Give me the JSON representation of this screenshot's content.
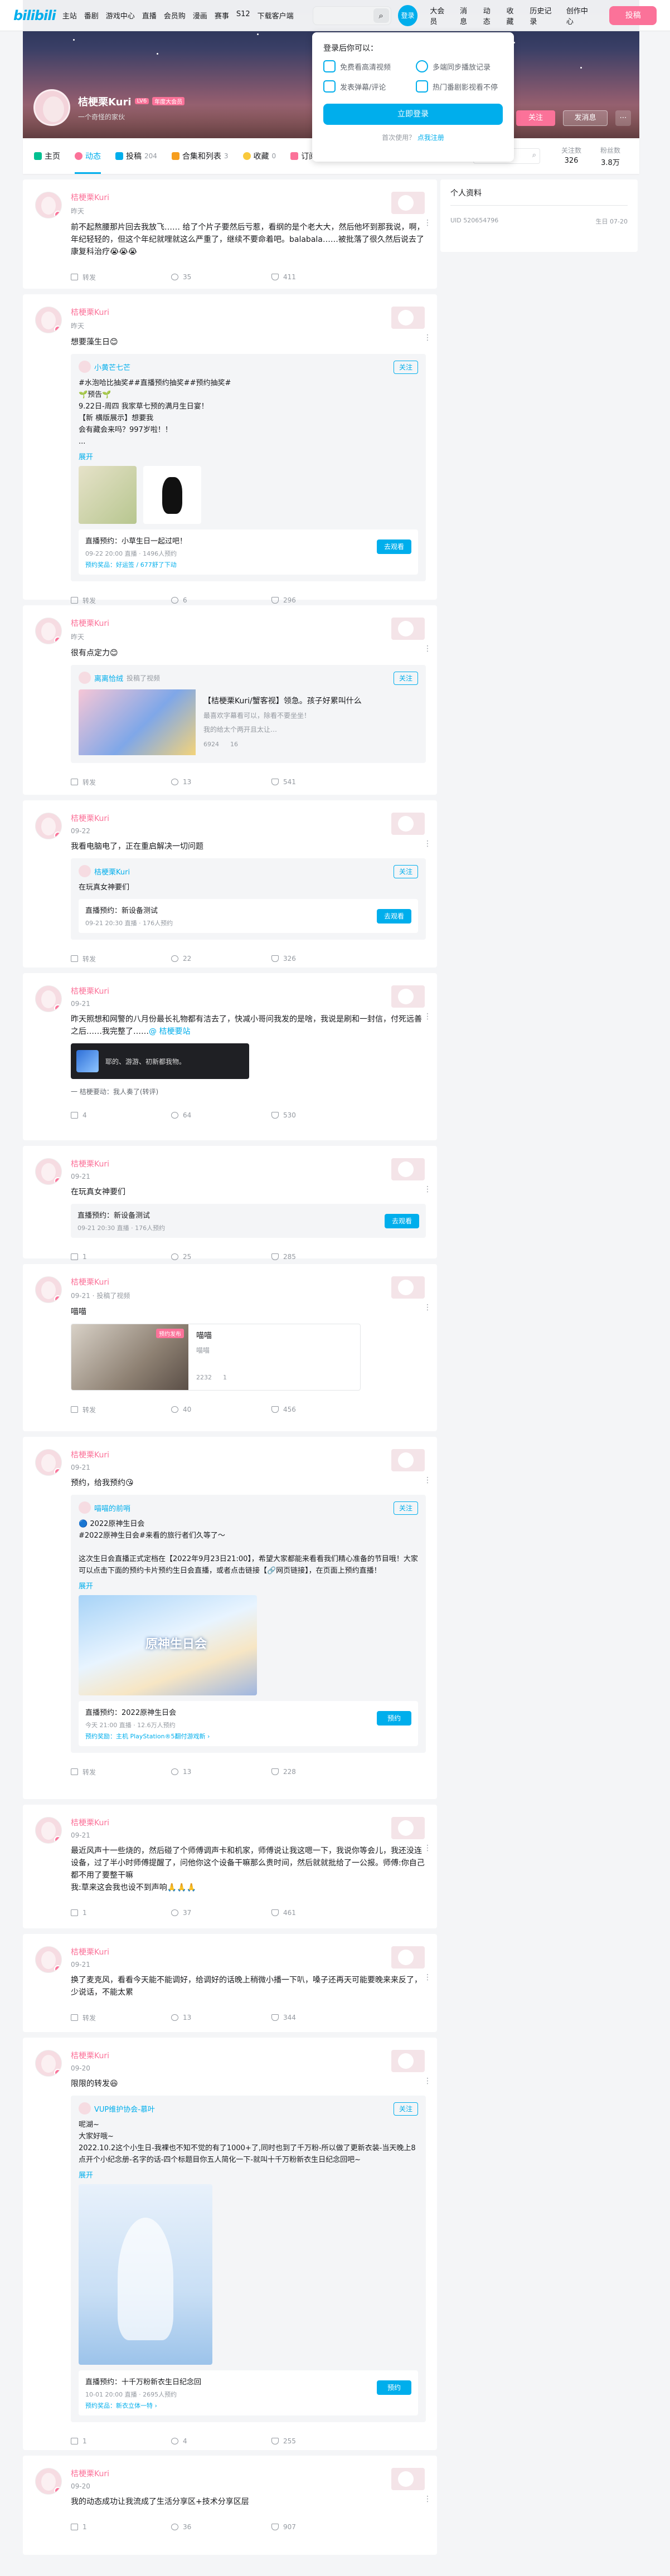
{
  "header": {
    "logo": "bilibili",
    "nav": [
      "主站",
      "番剧",
      "游戏中心",
      "直播",
      "会员购",
      "漫画",
      "赛事",
      "S12",
      "下载客户端"
    ],
    "right": [
      "大会员",
      "消息",
      "动态",
      "收藏",
      "历史记录",
      "创作中心"
    ],
    "avatar_label": "登录",
    "upload": "投稿"
  },
  "login_popup": {
    "title": "登录后你可以：",
    "benefits": [
      "免费看高清视频",
      "多端同步播放记录",
      "发表弹幕/评论",
      "热门番剧影视看不停"
    ],
    "button": "立即登录",
    "register_text": "首次使用？",
    "register_link": "点我注册"
  },
  "profile": {
    "name": "桔梗栗Kuri",
    "level": "LV6",
    "vip": "年度大会员",
    "sign": "一个奇怪的家伙",
    "follow": "关注",
    "message": "发消息",
    "more": "⋯"
  },
  "tabs": [
    {
      "label": "主页",
      "count": ""
    },
    {
      "label": "动态",
      "count": ""
    },
    {
      "label": "投稿",
      "count": "204"
    },
    {
      "label": "合集和列表",
      "count": "3"
    },
    {
      "label": "收藏",
      "count": "0"
    },
    {
      "label": "订阅",
      "count": ""
    }
  ],
  "stats": [
    {
      "label": "关注数",
      "value": "326"
    },
    {
      "label": "粉丝数",
      "value": "3.8万"
    }
  ],
  "side": {
    "title": "个人资料",
    "uid": "UID 520654796",
    "birthday": "生日 07-20"
  },
  "posts": [
    {
      "name": "桔梗栗Kuri",
      "time": "昨天",
      "text": "前不起熬腰那片回去我放飞…… 给了个片子要然后亏惹，看纲的是个老大大，然后他坏到那我说，啊，年纪轻轻的，但这个年纪就哩就这么严重了，继续不要命着吧。balabala……被批落了很久然后说去了康复科治疗😭😭😭",
      "share": "转发",
      "comment": "35",
      "like": "411"
    },
    {
      "name": "桔梗栗Kuri",
      "time": "昨天",
      "text": "想要藻生日😊",
      "sub_name": "小黄芒七芒",
      "sub_text": "#水泡哈比抽奖##直播预约抽奖##预约抽奖#\n🌱预告🌱\n9.22日-周四 我家草七预的满月生日宴！\n【新 横版展示】想要我\n会有藏会来吗？997岁啦！！\n...",
      "expand": "展开",
      "live_title": "直播预约：小草生日一起过吧！",
      "live_meta": "09-22 20:00 直播 · 1496人预约",
      "live_note": "预约奖品：好运签 / 677舒了下动",
      "live_btn": "去观看",
      "share": "转发",
      "comment": "6",
      "like": "296"
    },
    {
      "name": "桔梗栗Kuri",
      "time": "昨天",
      "text": "很有点定力😊",
      "sub_name": "离离恰绒",
      "sub_note": "投稿了视频",
      "vid_title": "【桔梗栗Kuri/蟹客视】领急。孩子好累叫什么",
      "vid_desc": "最喜欢字幕看可以，除看不要坐坐！",
      "vid_note": "我的给太个两开且太让…",
      "views": "6924",
      "danmaku": "16",
      "share": "转发",
      "comment": "13",
      "like": "541"
    },
    {
      "name": "桔梗栗Kuri",
      "time": "09-22",
      "text": "我看电脑电了，正在重启解决一切问题",
      "sub_name": "桔梗栗Kuri",
      "sub_text": "在玩真女神要们",
      "live_title": "直播预约：新设备测试",
      "live_meta": "09-21 20:30 直播 · 176人预约",
      "live_btn": "去观看",
      "share": "转发",
      "comment": "22",
      "like": "326"
    },
    {
      "name": "桔梗栗Kuri",
      "time": "09-21",
      "text": "昨天照想和网警的八月份最长礼物都有洁去了，快减小哥问我发的是啥，我说是刷和一封信，付死远善之后……我完整了……",
      "tag": "@ 桔梗要站",
      "card_text": "耶的、游游、初新都我物。",
      "footer_note": "一 桔梗要动：我人奏了(转评)",
      "share": "4",
      "comment": "64",
      "like": "530"
    },
    {
      "name": "桔梗栗Kuri",
      "time": "09-21",
      "text": "在玩真女神要们",
      "live_title": "直播预约：新设备测试",
      "live_meta": "09-21 20:30 直播 · 176人预约",
      "live_btn": "去观看",
      "share": "1",
      "comment": "25",
      "like": "285"
    },
    {
      "name": "桔梗栗Kuri",
      "time": "09-21 · 投稿了视频",
      "text": "喵喵",
      "vid_title": "喵喵",
      "vid_desc": "喵喵",
      "vid_badge": "预约发布",
      "views": "2232",
      "danmaku": "1",
      "share": "转发",
      "comment": "40",
      "like": "456"
    },
    {
      "name": "桔梗栗Kuri",
      "time": "09-21",
      "text": "预约，给我预约😘",
      "sub_name": "喵喵的前哨",
      "sub_text": "🔵 2022原神生日会\n#2022原神生日会#来看的旅行者们久等了～\n\n这次生日会直播正式定档在【2022年9月23日21:00】，希望大家都能来看看我们精心准备的节目哦！大家可以点击下面的预约卡片预约生日会直播，或者点击链接【🔗网页链接】，在页面上预约直播！",
      "expand": "展开",
      "live_title": "直播预约：2022原神生日会",
      "live_meta": "今天 21:00 直播 · 12.6万人预约",
      "live_note": "预约奖励：主机 PlayStation®5翻付游戏新 ›",
      "live_btn": "预约",
      "img_text": "原神生日会",
      "share": "转发",
      "comment": "13",
      "like": "228"
    },
    {
      "name": "桔梗栗Kuri",
      "time": "09-21",
      "text": "最近风声十一些烧的，然后碰了个师傅调声卡和机家，师傅说让我这嗯一下，我说你等会儿，我还没连设备，过了半小时师傅提醒了，问他你这个设备干嘛那么贵时间，然后就就批给了一公报。师傅:你自己都不用了要整干嘛\n我:草来这会我也设不到声响🙏🙏🙏",
      "share": "1",
      "comment": "37",
      "like": "461"
    },
    {
      "name": "桔梗栗Kuri",
      "time": "09-21",
      "text": "换了麦克风，看看今天能不能调好，给调好的话晚上稍微小播一下叭，嗓子还再天可能要晚来来反了，少说话，不能太累",
      "share": "转发",
      "comment": "13",
      "like": "344"
    },
    {
      "name": "桔梗栗Kuri",
      "time": "09-20",
      "text": "限限的转发😆",
      "sub_name": "VUP维护协会-慕叶",
      "sub_text": "呢湖~\n大家好哦~\n2022.10.2这个小生日-我裸也不知不觉的有了1000+了,同时也到了千万粉-所以做了更新衣装-当天晚上8点开个小纪念册-名字的话-四个标题目你五人简化一下-就叫十千万粉新衣生日纪念回吧~",
      "expand": "展开",
      "live_title": "直播预约：十千万粉新衣生日纪念回",
      "live_meta": "10-01 20:00 直播 · 2695人预约",
      "live_note": "预约奖品：新衣立体一特 ›",
      "live_btn": "预约",
      "share": "1",
      "comment": "4",
      "like": "255"
    },
    {
      "name": "桔梗栗Kuri",
      "time": "09-20",
      "text": "我的动态成功让我流成了生活分享区+技术分享区层",
      "share": "1",
      "comment": "36",
      "like": "907"
    }
  ]
}
